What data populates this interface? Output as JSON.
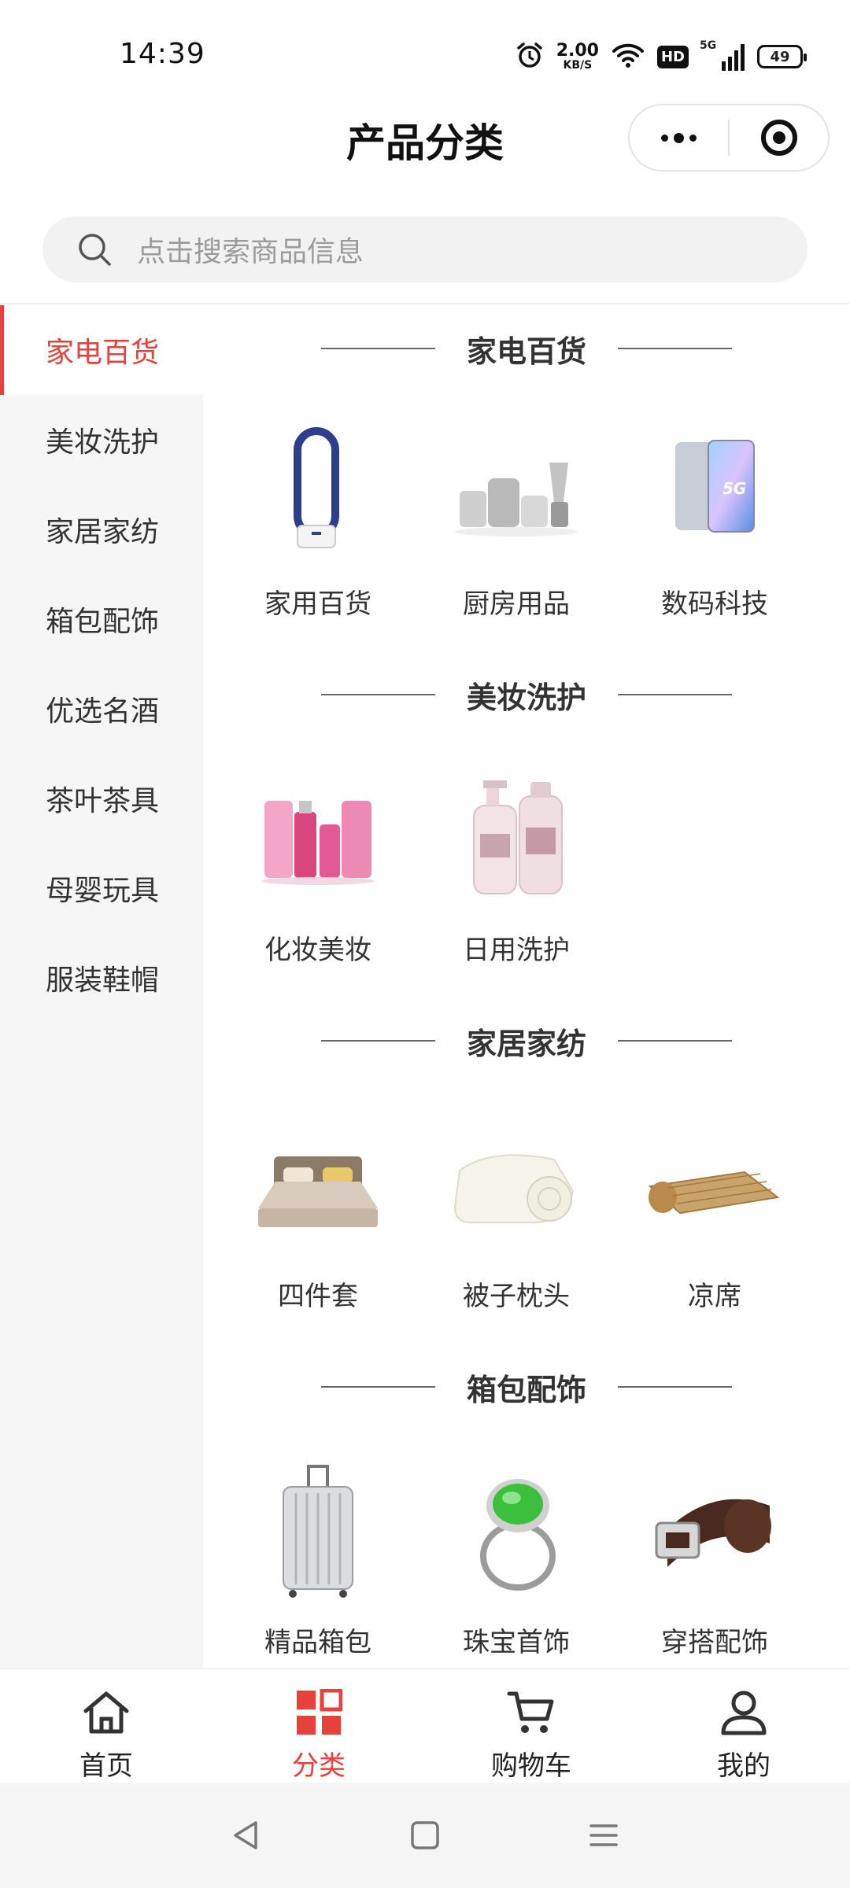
{
  "status_bar": {
    "time": "14:39",
    "net_speed_value": "2.00",
    "net_speed_unit": "KB/S",
    "hd_label": "HD",
    "signal_label": "5G",
    "battery": "49",
    "icons": [
      "alarm-icon",
      "wifi-icon",
      "hd-icon",
      "signal-5g-icon",
      "battery-icon"
    ]
  },
  "header": {
    "title": "产品分类",
    "capsule_icons": [
      "more-dots-icon",
      "target-close-icon"
    ]
  },
  "search": {
    "placeholder": "点击搜索商品信息",
    "icon": "search-icon"
  },
  "sidebar": {
    "active_index": 0,
    "items": [
      {
        "label": "家电百货"
      },
      {
        "label": "美妆洗护"
      },
      {
        "label": "家居家纺"
      },
      {
        "label": "箱包配饰"
      },
      {
        "label": "优选名酒"
      },
      {
        "label": "茶叶茶具"
      },
      {
        "label": "母婴玩具"
      },
      {
        "label": "服装鞋帽"
      }
    ]
  },
  "sections": [
    {
      "title": "家电百货",
      "items": [
        {
          "label": "家用百货",
          "icon": "bladeless-fan-image"
        },
        {
          "label": "厨房用品",
          "icon": "kitchen-appliances-image"
        },
        {
          "label": "数码科技",
          "icon": "smartphone-image"
        }
      ]
    },
    {
      "title": "美妆洗护",
      "items": [
        {
          "label": "化妆美妆",
          "icon": "cosmetics-image"
        },
        {
          "label": "日用洗护",
          "icon": "shampoo-bottles-image"
        }
      ]
    },
    {
      "title": "家居家纺",
      "items": [
        {
          "label": "四件套",
          "icon": "bed-image"
        },
        {
          "label": "被子枕头",
          "icon": "quilt-image"
        },
        {
          "label": "凉席",
          "icon": "bamboo-mat-image"
        }
      ]
    },
    {
      "title": "箱包配饰",
      "items": [
        {
          "label": "精品箱包",
          "icon": "suitcase-image"
        },
        {
          "label": "珠宝首饰",
          "icon": "jade-ring-image"
        },
        {
          "label": "穿搭配饰",
          "icon": "belt-image"
        }
      ]
    }
  ],
  "tab_bar": {
    "active_index": 1,
    "accent_color": "#e8403a",
    "items": [
      {
        "label": "首页",
        "icon": "home-icon"
      },
      {
        "label": "分类",
        "icon": "category-grid-icon"
      },
      {
        "label": "购物车",
        "icon": "cart-icon"
      },
      {
        "label": "我的",
        "icon": "user-icon"
      }
    ]
  },
  "nav_bar": {
    "icons": [
      "back-triangle-icon",
      "home-square-icon",
      "menu-lines-icon"
    ]
  }
}
